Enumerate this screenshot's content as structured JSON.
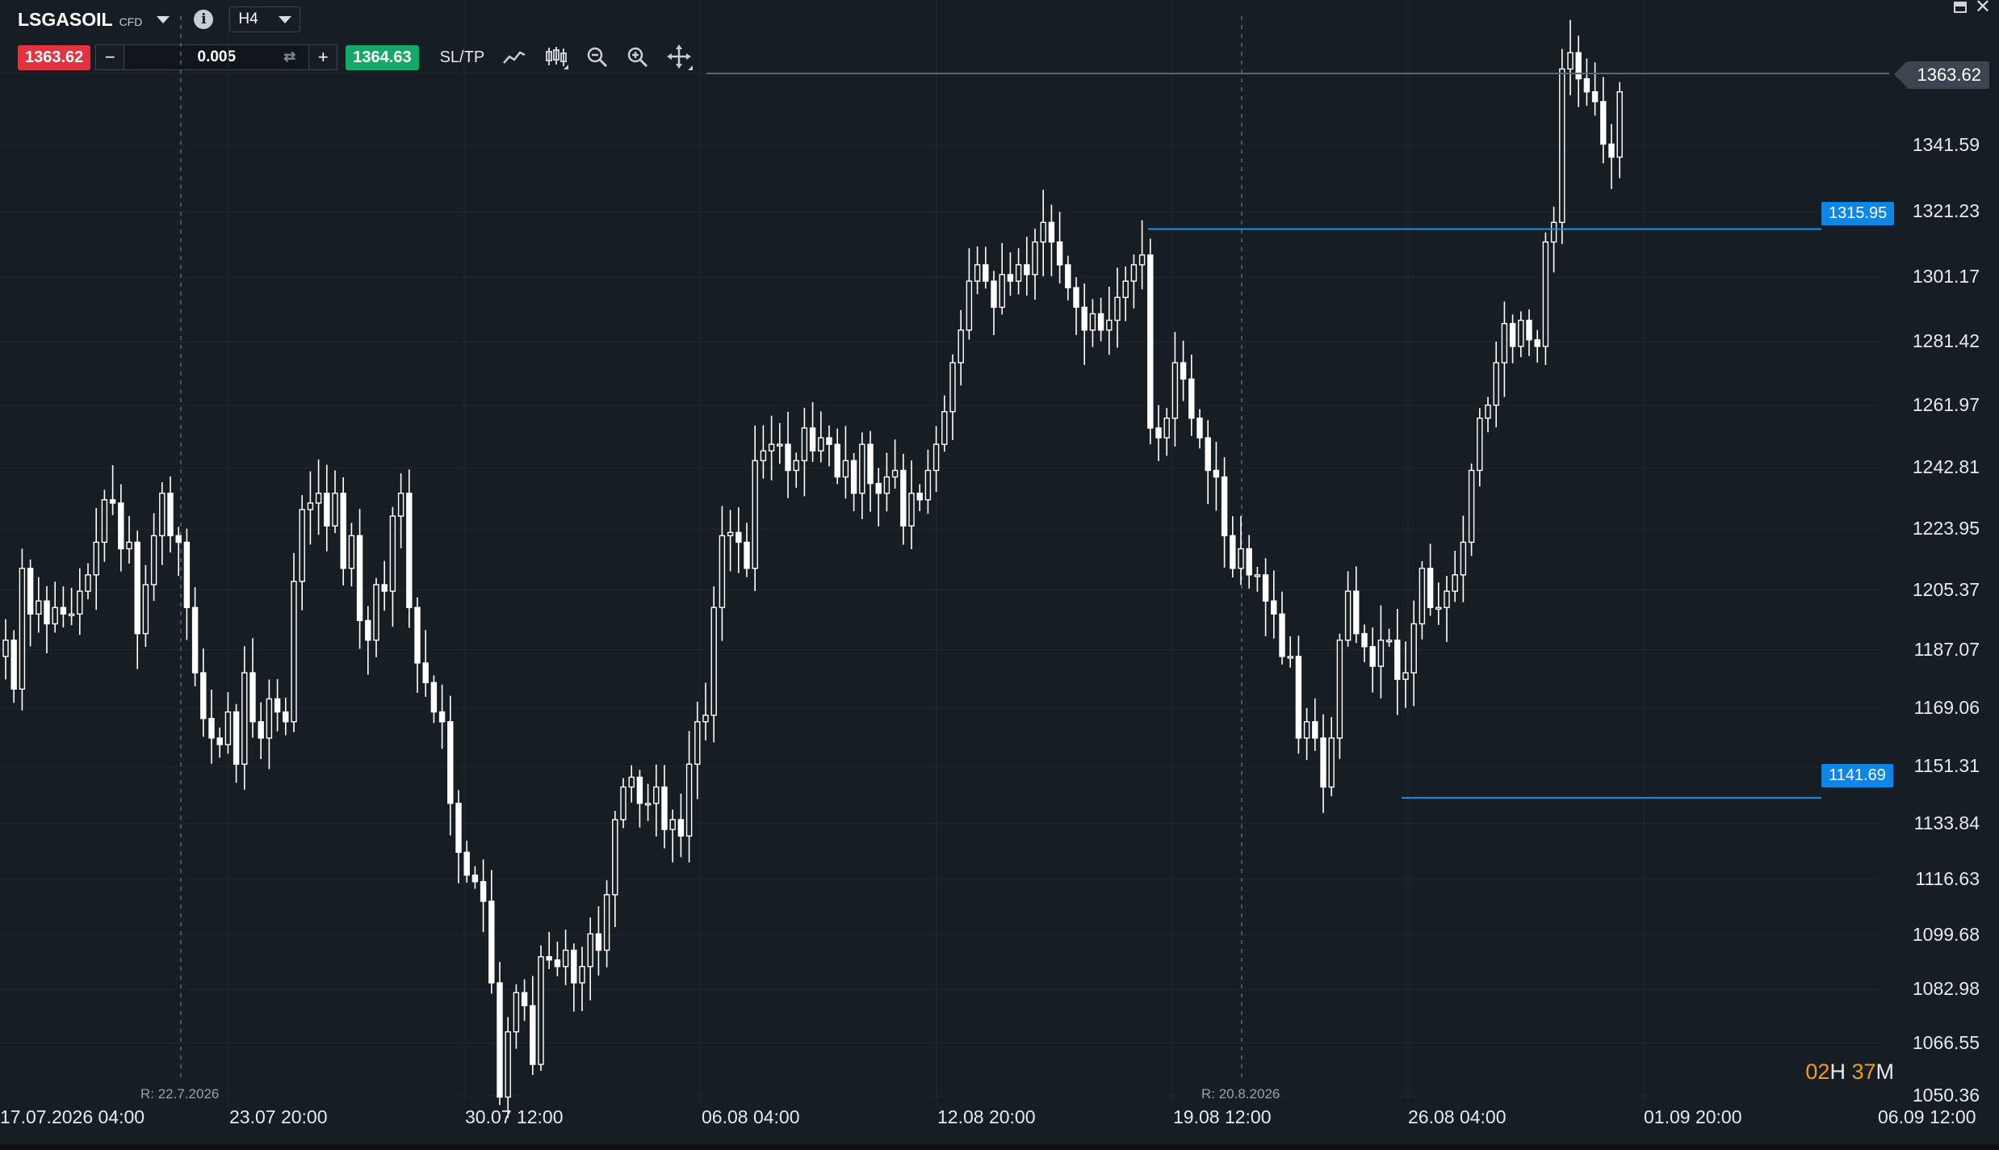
{
  "toolbar": {
    "symbol": "LSGASOIL",
    "instrument_type": "CFD",
    "timeframe": "H4",
    "sell_price": "1363.62",
    "buy_price": "1364.63",
    "quantity": "0.005",
    "minus": "−",
    "plus": "+",
    "sltp_label": "SL/TP",
    "info_glyph": "i",
    "swap_glyph": "⇄"
  },
  "price_tag": "1363.62",
  "levels": {
    "top": "1315.95",
    "bottom": "1141.69"
  },
  "timer": {
    "hours": "02",
    "h_unit": "H",
    "minutes": "37",
    "m_unit": "M"
  },
  "y_axis": [
    "1363.62",
    "1341.59",
    "1321.23",
    "1301.17",
    "1281.42",
    "1261.97",
    "1242.81",
    "1223.95",
    "1205.37",
    "1187.07",
    "1169.06",
    "1151.31",
    "1133.84",
    "1116.63",
    "1099.68",
    "1082.98",
    "1066.55",
    "1050.36"
  ],
  "x_axis": [
    "17.07.2026 04:00",
    "23.07 20:00",
    "30.07 12:00",
    "06.08 04:00",
    "12.08 20:00",
    "19.08 12:00",
    "26.08 04:00",
    "01.09 20:00",
    "06.09 12:00"
  ],
  "rollover_labels": [
    "R: 22.7.2026",
    "R: 20.8.2026"
  ],
  "colors": {
    "background": "#161d23",
    "sell": "#e2333f",
    "buy": "#16a868",
    "level": "#0f86e6",
    "timer": "#f39b1d",
    "candle": "#ffffff"
  },
  "icons": [
    "dropdown-icon",
    "info-icon",
    "swap-icon",
    "line-chart-icon",
    "candlestick-icon",
    "zoom-out-icon",
    "zoom-in-icon",
    "crosshair-icon",
    "minimize-icon",
    "close-icon"
  ],
  "chart_data": {
    "type": "candlestick",
    "ylim": [
      1050.36,
      1372
    ],
    "closes": [
      1190,
      1175,
      1212,
      1198,
      1202,
      1195,
      1200,
      1198,
      1198,
      1205,
      1210,
      1220,
      1233,
      1232,
      1218,
      1220,
      1192,
      1207,
      1222,
      1235,
      1222,
      1220,
      1200,
      1180,
      1166,
      1160,
      1158,
      1168,
      1152,
      1180,
      1165,
      1160,
      1172,
      1168,
      1165,
      1208,
      1230,
      1232,
      1235,
      1225,
      1235,
      1212,
      1222,
      1196,
      1190,
      1207,
      1205,
      1228,
      1235,
      1200,
      1183,
      1177,
      1168,
      1165,
      1140,
      1125,
      1118,
      1116,
      1110,
      1085,
      1050,
      1070,
      1082,
      1078,
      1060,
      1093,
      1092,
      1090,
      1095,
      1085,
      1090,
      1100,
      1095,
      1112,
      1135,
      1145,
      1148,
      1140,
      1140,
      1145,
      1132,
      1135,
      1130,
      1152,
      1165,
      1167,
      1200,
      1222,
      1223,
      1220,
      1212,
      1245,
      1248,
      1250,
      1250,
      1242,
      1245,
      1255,
      1248,
      1252,
      1250,
      1240,
      1245,
      1235,
      1250,
      1238,
      1235,
      1240,
      1242,
      1225,
      1235,
      1233,
      1242,
      1250,
      1260,
      1275,
      1285,
      1300,
      1305,
      1300,
      1292,
      1302,
      1300,
      1305,
      1302,
      1312,
      1318,
      1312,
      1305,
      1298,
      1292,
      1285,
      1290,
      1285,
      1288,
      1295,
      1300,
      1305,
      1308,
      1255,
      1252,
      1258,
      1275,
      1270,
      1258,
      1252,
      1242,
      1240,
      1222,
      1212,
      1218,
      1210,
      1210,
      1202,
      1198,
      1185,
      1185,
      1160,
      1165,
      1160,
      1145,
      1160,
      1190,
      1205,
      1192,
      1188,
      1182,
      1190,
      1190,
      1178,
      1180,
      1195,
      1212,
      1200,
      1200,
      1205,
      1210,
      1220,
      1242,
      1258,
      1262,
      1275,
      1287,
      1280,
      1288,
      1282,
      1280,
      1312,
      1318,
      1365,
      1370,
      1362,
      1358,
      1355,
      1342,
      1338,
      1358
    ],
    "timer": "02H 37M"
  }
}
